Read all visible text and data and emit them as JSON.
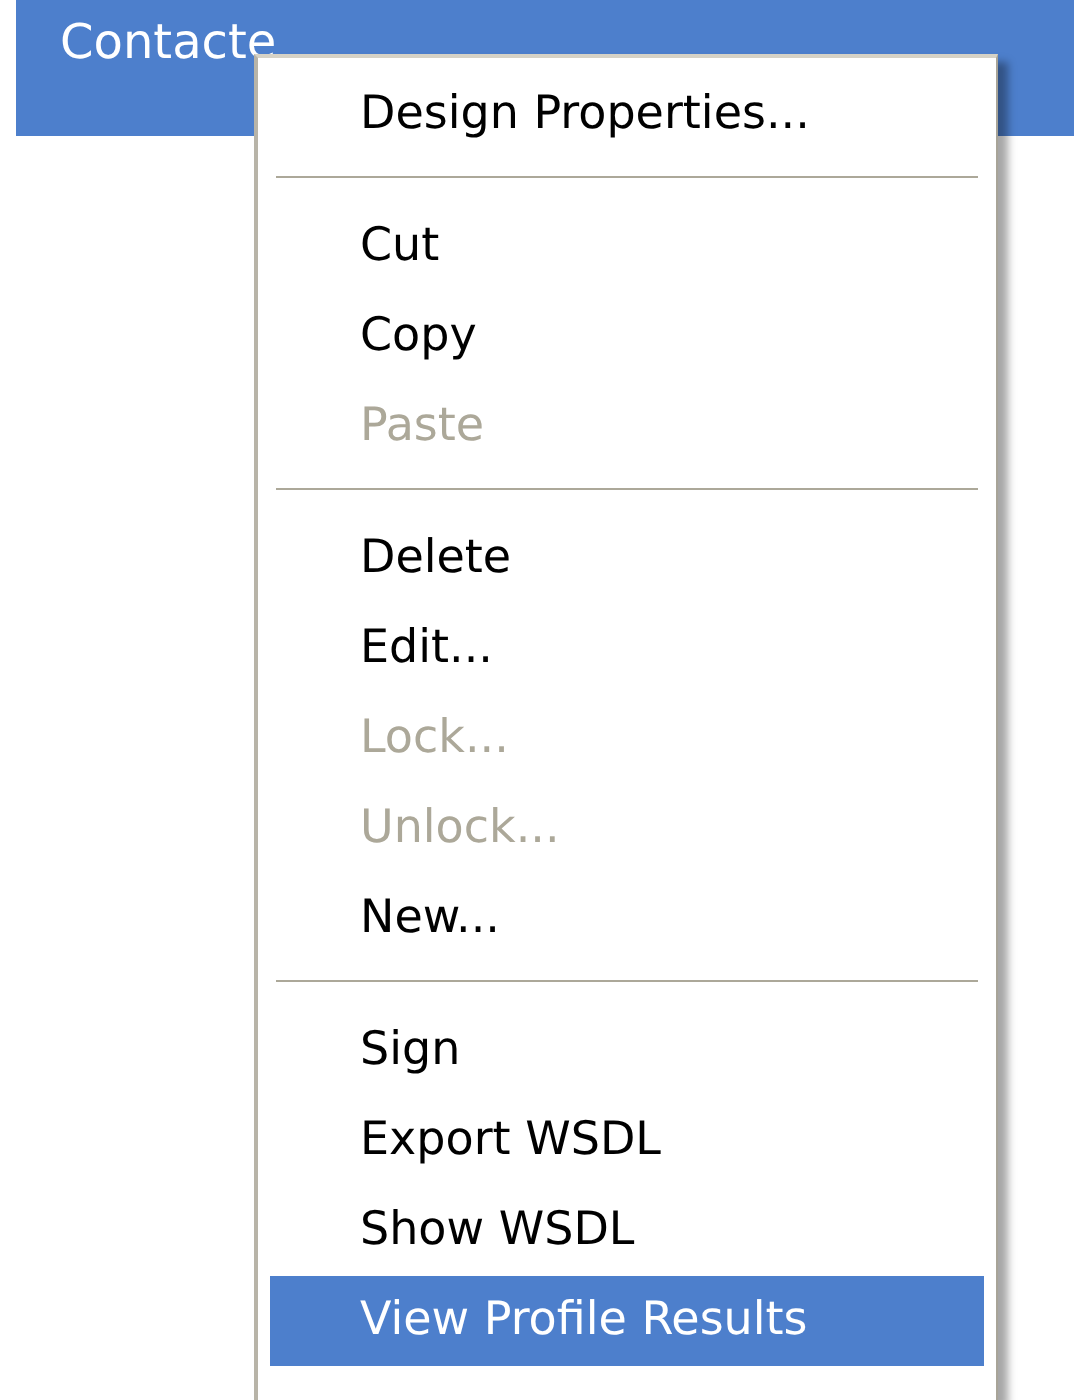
{
  "header": {
    "title": "Contacte"
  },
  "context_menu": {
    "groups": [
      [
        {
          "label": "Design Properties...",
          "disabled": false,
          "selected": false
        }
      ],
      [
        {
          "label": "Cut",
          "disabled": false,
          "selected": false
        },
        {
          "label": "Copy",
          "disabled": false,
          "selected": false
        },
        {
          "label": "Paste",
          "disabled": true,
          "selected": false
        }
      ],
      [
        {
          "label": "Delete",
          "disabled": false,
          "selected": false
        },
        {
          "label": "Edit...",
          "disabled": false,
          "selected": false
        },
        {
          "label": "Lock...",
          "disabled": true,
          "selected": false
        },
        {
          "label": "Unlock...",
          "disabled": true,
          "selected": false
        },
        {
          "label": "New...",
          "disabled": false,
          "selected": false
        }
      ],
      [
        {
          "label": "Sign",
          "disabled": false,
          "selected": false
        },
        {
          "label": "Export WSDL",
          "disabled": false,
          "selected": false
        },
        {
          "label": "Show WSDL",
          "disabled": false,
          "selected": false
        },
        {
          "label": "View Profile Results",
          "disabled": false,
          "selected": true
        }
      ]
    ]
  }
}
